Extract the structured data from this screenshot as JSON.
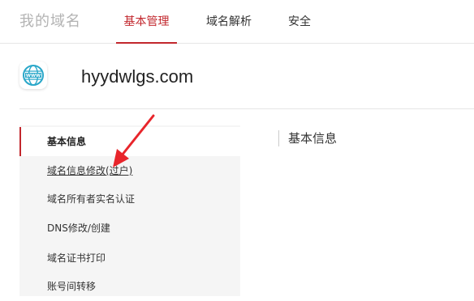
{
  "header": {
    "brand": "我的域名",
    "tabs": [
      {
        "label": "基本管理",
        "active": true
      },
      {
        "label": "域名解析",
        "active": false
      },
      {
        "label": "安全",
        "active": false
      }
    ]
  },
  "domain": {
    "name": "hyydwlgs.com",
    "icon": "www-globe-icon",
    "icon_text": "WWW"
  },
  "sidebar": {
    "items": [
      {
        "label": "基本信息",
        "active": true
      },
      {
        "label": "域名信息修改(过户)",
        "active": false
      },
      {
        "label": "域名所有者实名认证",
        "active": false
      },
      {
        "label": "DNS修改/创建",
        "active": false
      },
      {
        "label": "域名证书打印",
        "active": false
      },
      {
        "label": "账号间转移",
        "active": false
      }
    ]
  },
  "main": {
    "section_title": "基本信息"
  },
  "colors": {
    "accent": "#c2272d",
    "icon_teal": "#2aa7c9",
    "annotation_arrow": "#e8252b"
  }
}
